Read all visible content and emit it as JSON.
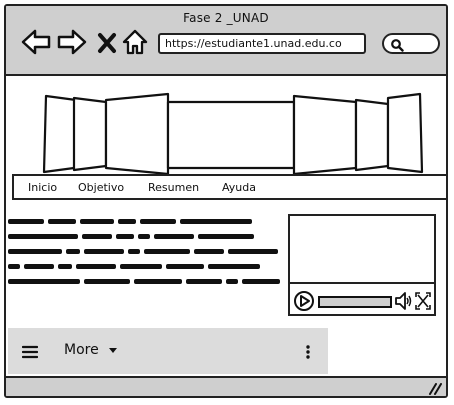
{
  "window": {
    "title": "Fase 2 _UNAD",
    "url": "https://estudiante1.unad.edu.co"
  },
  "toolbar": {
    "back_icon": "back-arrow-icon",
    "forward_icon": "forward-arrow-icon",
    "close_icon": "close-icon",
    "home_icon": "home-icon",
    "search_icon": "search-icon"
  },
  "nav": {
    "items": [
      {
        "label": "Inicio"
      },
      {
        "label": "Objetivo"
      },
      {
        "label": "Resumen"
      },
      {
        "label": "Ayuda"
      }
    ]
  },
  "mobile_menu": {
    "more_label": "More",
    "menu_icon": "hamburger-icon",
    "options_icon": "kebab-icon",
    "caret_icon": "caret-down-icon"
  },
  "video_player": {
    "play_icon": "play-icon",
    "volume_icon": "volume-icon",
    "fullscreen_icon": "fullscreen-icon"
  },
  "colors": {
    "chrome": "#cfcfcf",
    "menu_bar": "#dcdcdc",
    "stroke": "#222222"
  }
}
